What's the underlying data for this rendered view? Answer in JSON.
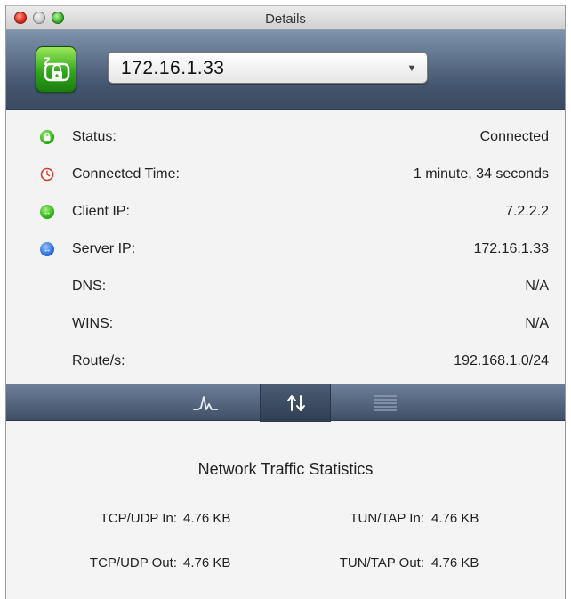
{
  "window": {
    "title": "Details"
  },
  "header": {
    "server_select_value": "172.16.1.33"
  },
  "details": {
    "rows": [
      {
        "label": "Status:",
        "value": "Connected",
        "icon": "lock-status-icon"
      },
      {
        "label": "Connected Time:",
        "value": "1 minute, 34 seconds",
        "icon": "clock-icon"
      },
      {
        "label": "Client IP:",
        "value": "7.2.2.2",
        "icon": "client-ip-icon"
      },
      {
        "label": "Server IP:",
        "value": "172.16.1.33",
        "icon": "server-ip-icon"
      },
      {
        "label": "DNS:",
        "value": "N/A"
      },
      {
        "label": "WINS:",
        "value": "N/A"
      },
      {
        "label": "Route/s:",
        "value": "192.168.1.0/24"
      }
    ]
  },
  "tabs": [
    {
      "name": "graph-tab",
      "icon": "activity-graph-icon",
      "selected": false
    },
    {
      "name": "traffic-tab",
      "icon": "up-down-arrows-icon",
      "selected": true
    },
    {
      "name": "log-tab",
      "icon": "log-lines-icon",
      "selected": false
    }
  ],
  "stats": {
    "title": "Network Traffic Statistics",
    "tcp_udp_in_label": "TCP/UDP In:",
    "tcp_udp_in_value": "4.76 KB",
    "tun_tap_in_label": "TUN/TAP In:",
    "tun_tap_in_value": "4.76 KB",
    "tcp_udp_out_label": "TCP/UDP Out:",
    "tcp_udp_out_value": "4.76 KB",
    "tun_tap_out_label": "TUN/TAP Out:",
    "tun_tap_out_value": "4.76 KB"
  },
  "colors": {
    "header_top": "#7e93ad",
    "header_bottom": "#3a4a61",
    "status_green": "#2fb31c",
    "server_blue": "#2a6fe0",
    "clock_red": "#d93a2b"
  }
}
